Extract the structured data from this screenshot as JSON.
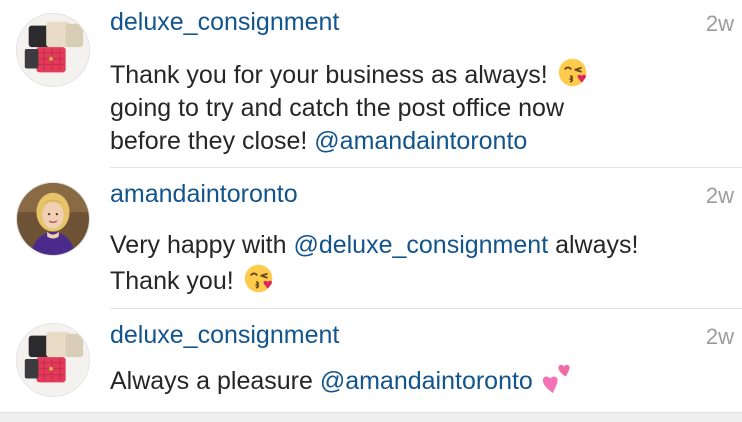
{
  "comments": [
    {
      "username": "deluxe_consignment",
      "time": "2w",
      "avatar": "handbags-avatar",
      "lines": [
        {
          "text": "Thank you for your business as always! ",
          "emoji": "kissing-face-with-heart-emoji"
        },
        {
          "text": "going to try and catch the post office now"
        },
        {
          "text": "before they close! ",
          "mention": "@amandaintoronto"
        }
      ]
    },
    {
      "username": "amandaintoronto",
      "time": "2w",
      "avatar": "woman-portrait-avatar",
      "lines": [
        {
          "text": "Very happy with ",
          "mention": "@deluxe_consignment",
          "after": " always!"
        },
        {
          "text": "Thank you! ",
          "emoji": "kissing-face-with-heart-emoji"
        }
      ]
    },
    {
      "username": "deluxe_consignment",
      "time": "2w",
      "avatar": "handbags-avatar",
      "lines": [
        {
          "text": "Always a pleasure ",
          "mention": "@amandaintoronto",
          "emoji": "two-hearts-emoji"
        }
      ]
    }
  ],
  "colors": {
    "username": "#12548c",
    "mention": "#12548c",
    "text": "#262626",
    "timestamp": "#9c9c9c"
  }
}
